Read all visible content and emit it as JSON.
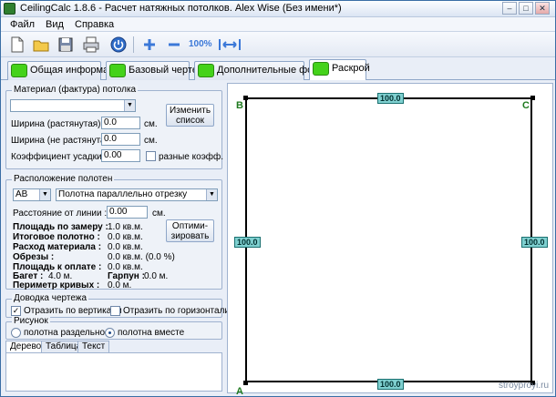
{
  "window": {
    "title": "CeilingCalc 1.8.6 - Расчет натяжных потолков. Alex Wise (Без имени*)",
    "minimize": "–",
    "maximize": "□",
    "close": "✕"
  },
  "menu": [
    "Файл",
    "Вид",
    "Справка"
  ],
  "toolbar": {
    "icons": [
      "new-document-icon",
      "open-folder-icon",
      "save-icon",
      "print-icon",
      "power-icon",
      "zoom-in-icon",
      "zoom-out-icon",
      "zoom-100-icon",
      "fit-icon"
    ],
    "zoom100_label": "100%"
  },
  "tabs": [
    "Общая информация",
    "Базовый чертеж",
    "Дополнительные формы",
    "Раскрой"
  ],
  "active_tab": "Раскрой",
  "material": {
    "group_title": "Материал (фактура) потолка",
    "select_value": "",
    "change_list_button": "Изменить список",
    "width_stretched_label": "Ширина (растянутая) :",
    "width_stretched_value": "0.0",
    "width_unit": "см.",
    "width_unstretched_label": "Ширина (не растянутая) :",
    "width_unstretched_value": "0.0",
    "width_unit2": "см.",
    "shrink_label": "Коэффициент усадки (x):",
    "shrink_value": "0.00",
    "different_coef_label": "разные коэфф."
  },
  "layout": {
    "group_title": "Расположение полотен",
    "side_value": "AB",
    "direction_value": "Полотна параллельно отрезку",
    "distance_label": "Расстояние от линии :",
    "distance_value": "0.00",
    "distance_unit": "см.",
    "optimize_button": "Оптими-зировать",
    "stats": [
      {
        "label": "Площадь по замеру :",
        "value": "1.0 кв.м."
      },
      {
        "label": "Итоговое полотно :",
        "value": "0.0 кв.м."
      },
      {
        "label": "Расход материала :",
        "value": "0.0 кв.м."
      },
      {
        "label": "Обрезы :",
        "value": "0.0 кв.м. (0.0 %)"
      },
      {
        "label": "Площадь к оплате :",
        "value": "0.0 кв.м."
      }
    ],
    "baguette_label": "Багет :",
    "baguette_value": "4.0 м.",
    "harpoon_label": "Гарпун :",
    "harpoon_value": "0.0 м.",
    "perimeter_label": "Периметр кривых :",
    "perimeter_value": "0.0 м."
  },
  "drawing_refine": {
    "group_title": "Доводка чертежа",
    "flip_vertical_label": "Отразить по вертикали",
    "flip_vertical_checked": true,
    "flip_horizontal_label": "Отразить по горизонтали",
    "flip_horizontal_checked": false
  },
  "picture": {
    "group_title": "Рисунок",
    "separately_label": "полотна раздельно",
    "together_label": "полотна вместе",
    "selected": "together"
  },
  "bottom_tabs": [
    "Дерево",
    "Таблица",
    "Текст"
  ],
  "canvas": {
    "corner_a": "A",
    "corner_b": "B",
    "corner_c": "C",
    "dim_top": "100.0",
    "dim_bottom": "100.0",
    "dim_left": "100.0",
    "dim_right": "100.0",
    "watermark": "stroyproyi.ru"
  },
  "colors": {
    "tab_square": "#44d21a",
    "dim_box": "#7fd0d0",
    "corner_label": "#1f7a1f"
  }
}
